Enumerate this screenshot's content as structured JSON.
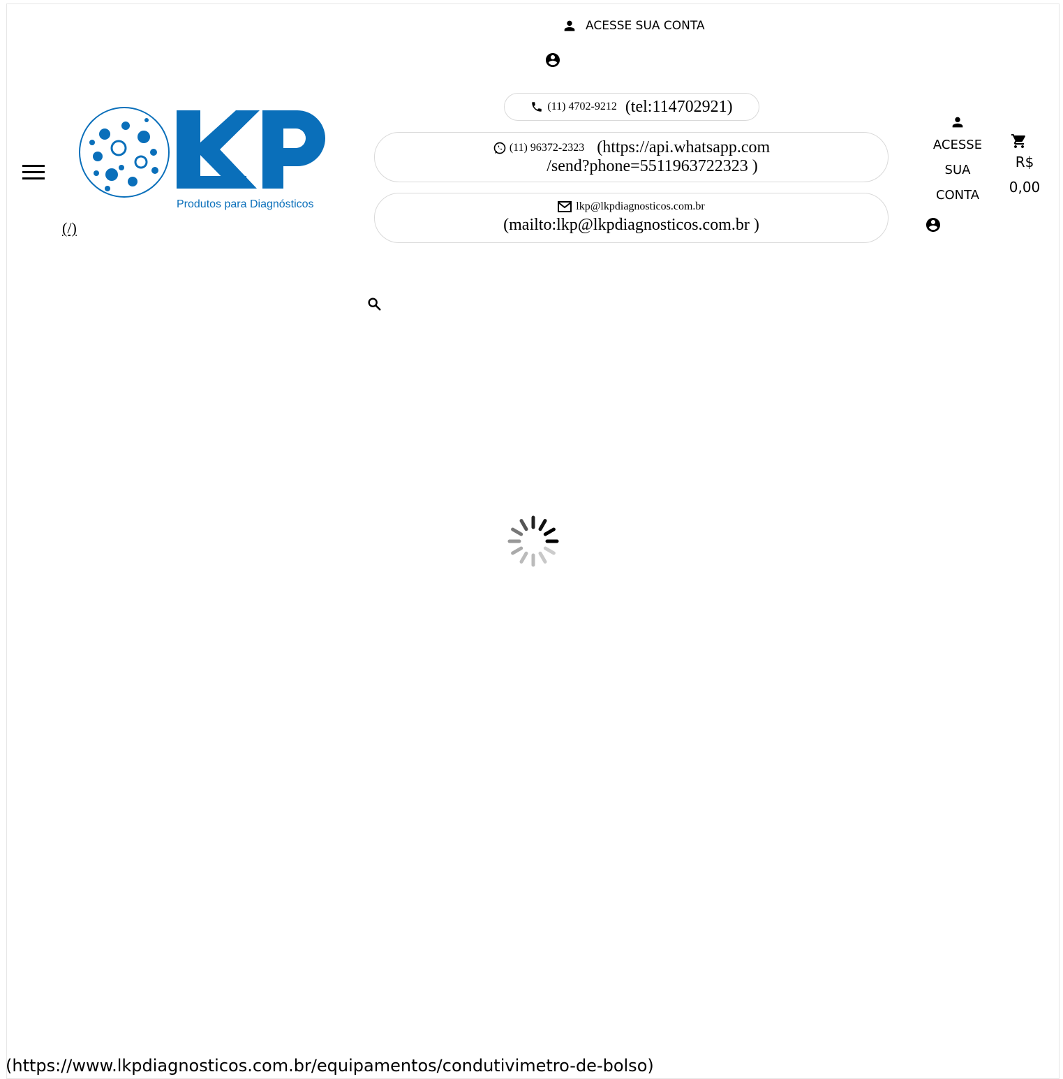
{
  "header": {
    "top_account_label": "ACESSE SUA CONTA",
    "home_link": "(/)",
    "logo": {
      "brand_text": "LKP",
      "tagline": "Produtos para Diagnósticos",
      "brand_color": "#0a6fba"
    }
  },
  "contacts": {
    "phone": {
      "label": "(11) 4702-9212",
      "href_text": "(tel:114702921)"
    },
    "whatsapp": {
      "label": "(11) 96372-2323",
      "href_line1": "(https://api.whatsapp.com",
      "href_line2": "/send?phone=5511963722323  )"
    },
    "email": {
      "label": "lkp@lkpdiagnosticos.com.br",
      "href_text": "(mailto:lkp@lkpdiagnosticos.com.br     )"
    }
  },
  "account": {
    "line1": "ACESSE",
    "line2": "SUA",
    "line3": "CONTA"
  },
  "cart": {
    "currency": "R$",
    "amount": "0,00"
  },
  "footer": {
    "url": "(https://www.lkpdiagnosticos.com.br/equipamentos/condutivimetro-de-bolso)"
  },
  "icons": {
    "person": "person-icon",
    "account_circle": "account-circle-icon",
    "phone": "phone-icon",
    "whatsapp": "whatsapp-icon",
    "mail": "mail-icon",
    "cart": "cart-icon",
    "search": "search-icon",
    "menu": "menu-icon",
    "spinner": "loading-spinner"
  }
}
